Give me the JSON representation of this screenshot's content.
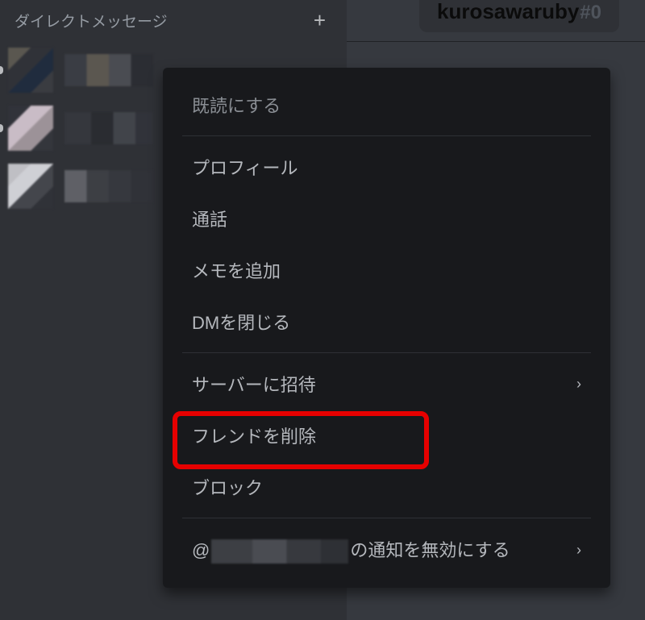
{
  "sidebar": {
    "title": "ダイレクトメッセージ"
  },
  "header": {
    "username": "kurosawaruby",
    "discriminator_prefix": "#0"
  },
  "context_menu": {
    "mark_read": "既読にする",
    "profile": "プロフィール",
    "call": "通話",
    "add_note": "メモを追加",
    "close_dm": "DMを閉じる",
    "invite_server": "サーバーに招待",
    "remove_friend": "フレンドを削除",
    "block": "ブロック",
    "mute_prefix": "@",
    "mute_suffix": "の通知を無効にする"
  }
}
